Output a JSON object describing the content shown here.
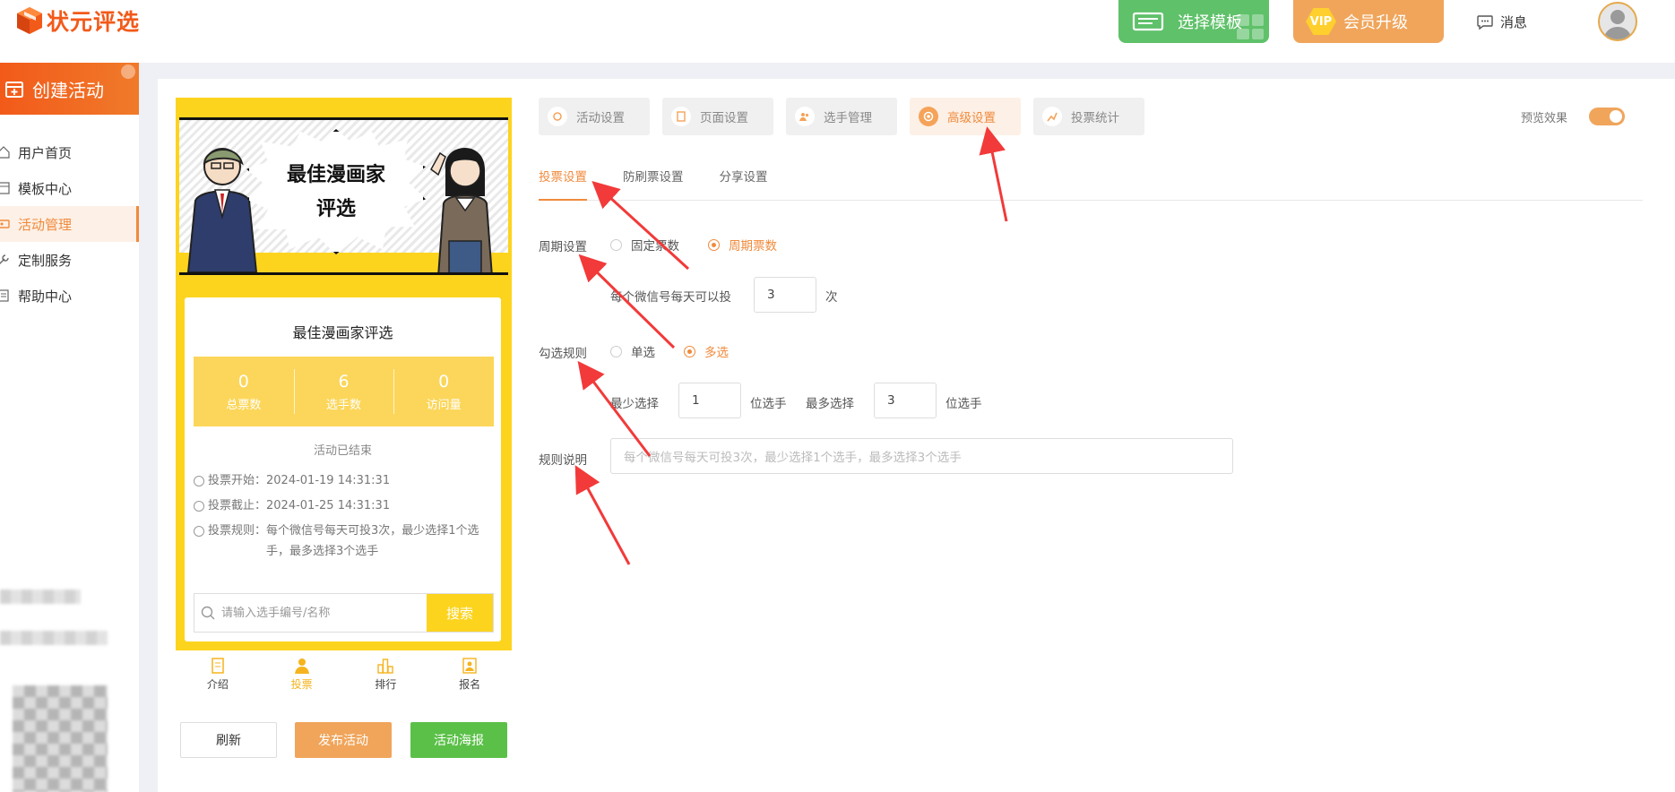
{
  "app": {
    "logo_text": "状元评选"
  },
  "header": {
    "template_button": "选择模板",
    "vip_badge": "VIP",
    "vip_button": "会员升级",
    "messages": "消息"
  },
  "sidebar": {
    "create_button": "创建活动",
    "items": [
      {
        "label": "用户首页"
      },
      {
        "label": "模板中心"
      },
      {
        "label": "活动管理"
      },
      {
        "label": "定制服务"
      },
      {
        "label": "帮助中心"
      }
    ]
  },
  "preview": {
    "banner_text_line1": "最佳漫画家",
    "banner_text_line2": "评选",
    "title": "最佳漫画家评选",
    "stats": [
      {
        "value": "0",
        "label": "总票数"
      },
      {
        "value": "6",
        "label": "选手数"
      },
      {
        "value": "0",
        "label": "访问量"
      }
    ],
    "status": "活动已结束",
    "vote_start_label": "投票开始：",
    "vote_start": "2024-01-19 14:31:31",
    "vote_end_label": "投票截止：",
    "vote_end": "2024-01-25 14:31:31",
    "vote_rule_label": "投票规则：",
    "vote_rule": "每个微信号每天可投3次，最少选择1个选手，最多选择3个选手",
    "search_placeholder": "请输入选手编号/名称",
    "search_button": "搜索",
    "tabs": [
      {
        "label": "介绍"
      },
      {
        "label": "投票"
      },
      {
        "label": "排行"
      },
      {
        "label": "报名"
      }
    ],
    "refresh_button": "刷新",
    "publish_button": "发布活动",
    "poster_button": "活动海报"
  },
  "steps": [
    {
      "label": "活动设置"
    },
    {
      "label": "页面设置"
    },
    {
      "label": "选手管理"
    },
    {
      "label": "高级设置"
    },
    {
      "label": "投票统计"
    }
  ],
  "preview_toggle_label": "预览效果",
  "subtabs": [
    {
      "label": "投票设置"
    },
    {
      "label": "防刷票设置"
    },
    {
      "label": "分享设置"
    }
  ],
  "form": {
    "cycle_label": "周期设置",
    "cycle_fixed": "固定票数",
    "cycle_periodic": "周期票数",
    "per_day_prefix": "每个微信号每天可以投",
    "per_day_value": "3",
    "per_day_suffix": "次",
    "select_rule_label": "勾选规则",
    "single": "单选",
    "multi": "多选",
    "min_label": "最少选择",
    "min_value": "1",
    "min_suffix": "位选手",
    "max_label": "最多选择",
    "max_value": "3",
    "max_suffix": "位选手",
    "rule_desc_label": "规则说明",
    "rule_desc_placeholder": "每个微信号每天可投3次，最少选择1个选手，最多选择3个选手"
  },
  "colors": {
    "accent": "#f08a3c",
    "green": "#5fc16a",
    "yellow": "#fcd41e",
    "arrow": "#f23a3a"
  }
}
